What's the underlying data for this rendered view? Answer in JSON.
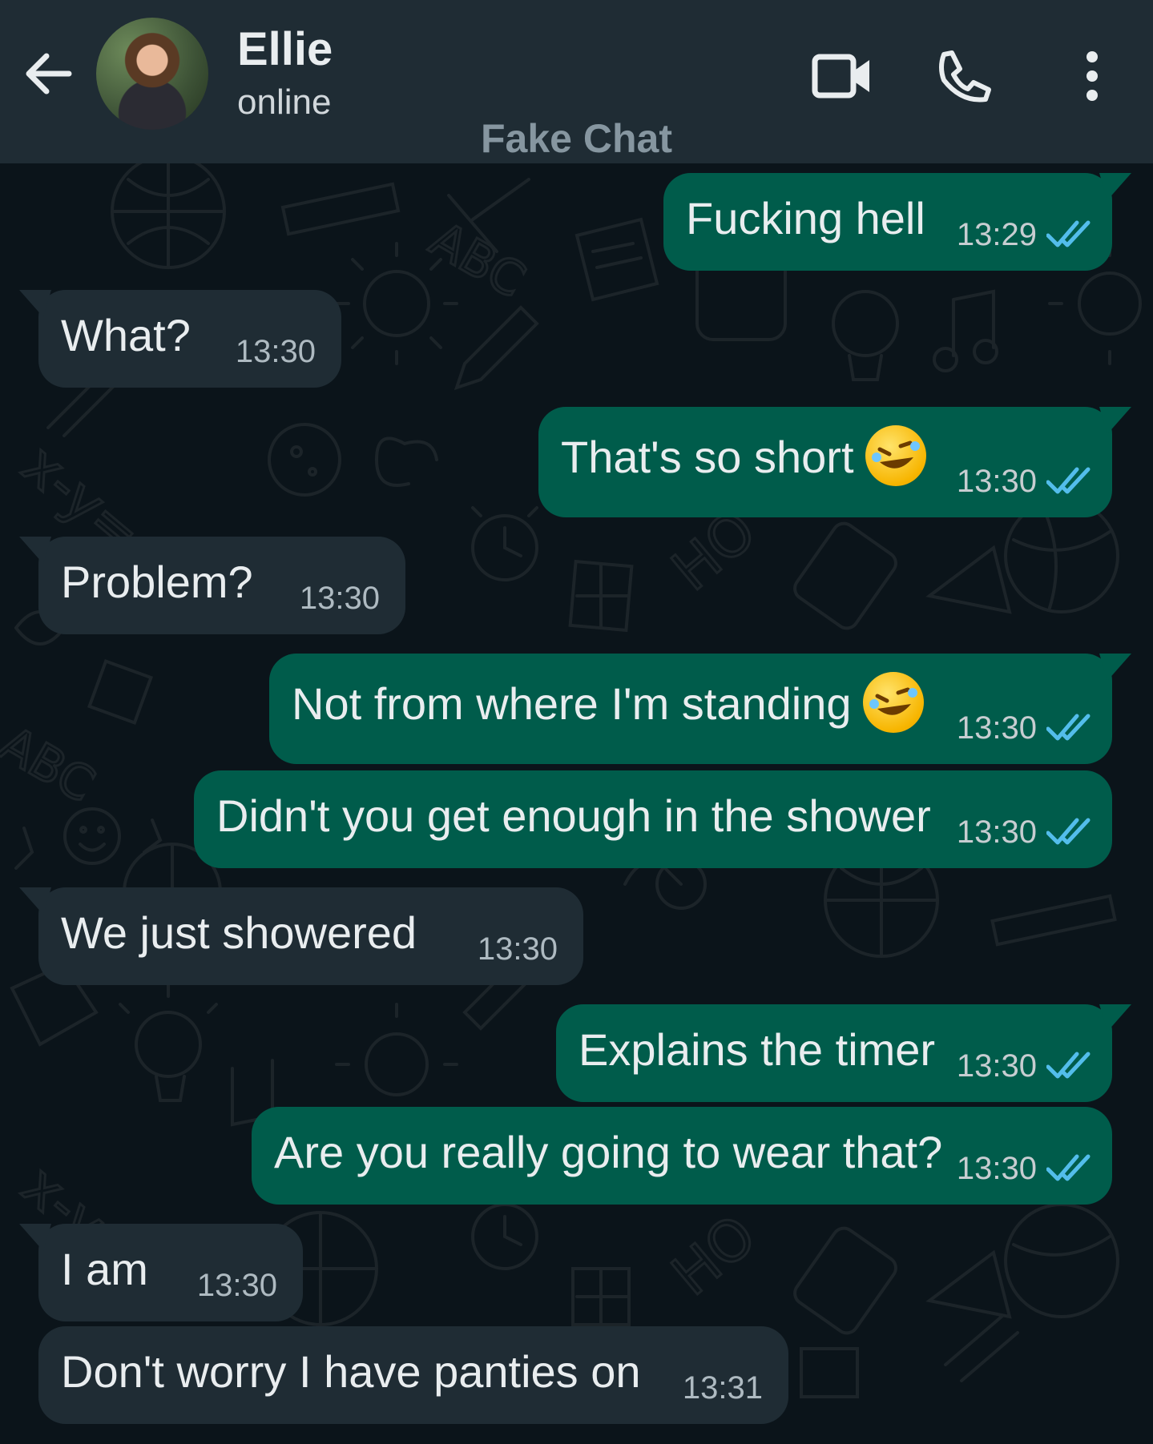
{
  "header": {
    "contact_name": "Ellie",
    "status": "online",
    "watermark": "Fake Chat"
  },
  "icons": {
    "back": "arrow-left-icon",
    "video": "video-camera-icon",
    "call": "phone-icon",
    "menu": "more-vertical-icon",
    "read_receipt": "double-check-icon",
    "emoji": "rolling-on-floor-laughing-emoji"
  },
  "colors": {
    "header_bg": "#1f2c34",
    "chat_bg": "#0b141a",
    "outgoing_bubble": "#005c4b",
    "incoming_bubble": "#1f2c34",
    "read_tick": "#53bdeb"
  },
  "messages": [
    {
      "direction": "out",
      "text": "Fucking hell",
      "time": "13:29",
      "read": true
    },
    {
      "direction": "in",
      "text": "What?",
      "time": "13:30"
    },
    {
      "direction": "out",
      "text": "That's so short",
      "emoji": true,
      "time": "13:30",
      "read": true
    },
    {
      "direction": "in",
      "text": "Problem?",
      "time": "13:30"
    },
    {
      "direction": "out",
      "text": "Not from where I'm standing",
      "emoji": true,
      "time": "13:30",
      "read": true
    },
    {
      "direction": "out",
      "text": "Didn't you get enough in the shower",
      "time": "13:30",
      "read": true
    },
    {
      "direction": "in",
      "text": "We just showered",
      "time": "13:30"
    },
    {
      "direction": "out",
      "text": "Explains the timer",
      "time": "13:30",
      "read": true
    },
    {
      "direction": "out",
      "text": "Are you really going to wear that?",
      "time": "13:30",
      "read": true
    },
    {
      "direction": "in",
      "text": "I am",
      "time": "13:30"
    },
    {
      "direction": "in",
      "text": "Don't worry I have panties on",
      "time": "13:31"
    }
  ]
}
